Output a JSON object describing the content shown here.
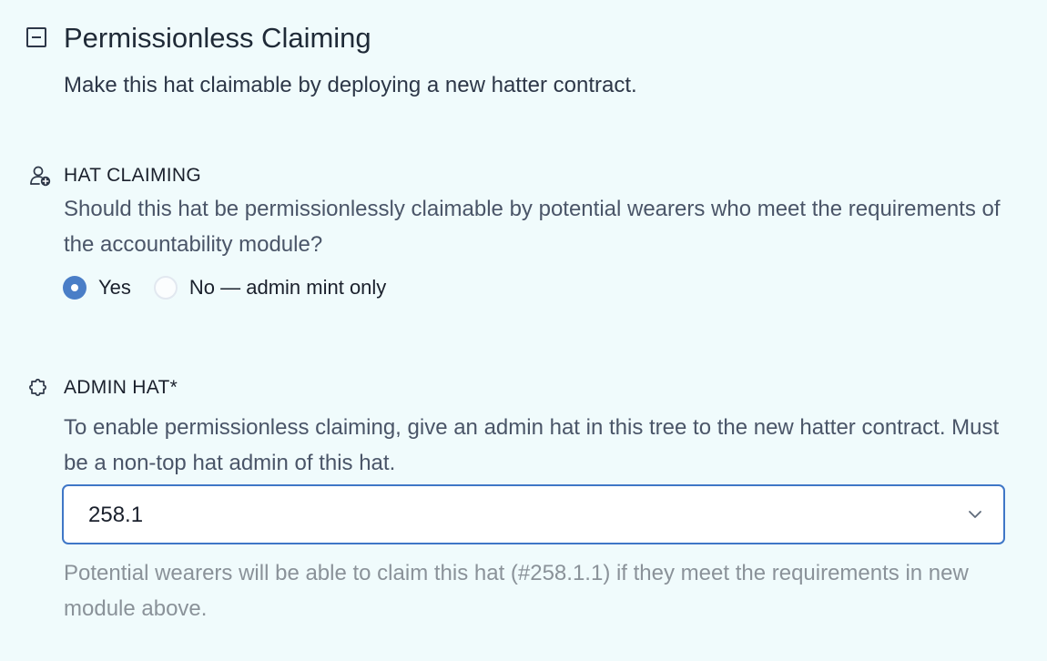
{
  "section": {
    "title": "Permissionless Claiming",
    "subtitle": "Make this hat claimable by deploying a new hatter contract."
  },
  "hat_claiming": {
    "icon": "user-add-icon",
    "label": "HAT CLAIMING",
    "description": "Should this hat be permissionlessly claimable by potential wearers who meet the requirements of the accountability module?",
    "options": [
      {
        "label": "Yes",
        "selected": true
      },
      {
        "label": "No — admin mint only",
        "selected": false
      }
    ]
  },
  "admin_hat": {
    "icon": "puzzle-icon",
    "label": "ADMIN HAT*",
    "description": "To enable permissionless claiming, give an admin hat in this tree to the new hatter contract. Must be a non-top hat admin of this hat.",
    "selected_value": "258.1",
    "helper": "Potential wearers will be able to claim this hat (#258.1.1) if they meet the requirements in new module above."
  },
  "colors": {
    "background": "#f0fbfc",
    "accent": "#4a7ec7",
    "select_border": "#3f77c7",
    "helper_text": "#8a9299"
  }
}
